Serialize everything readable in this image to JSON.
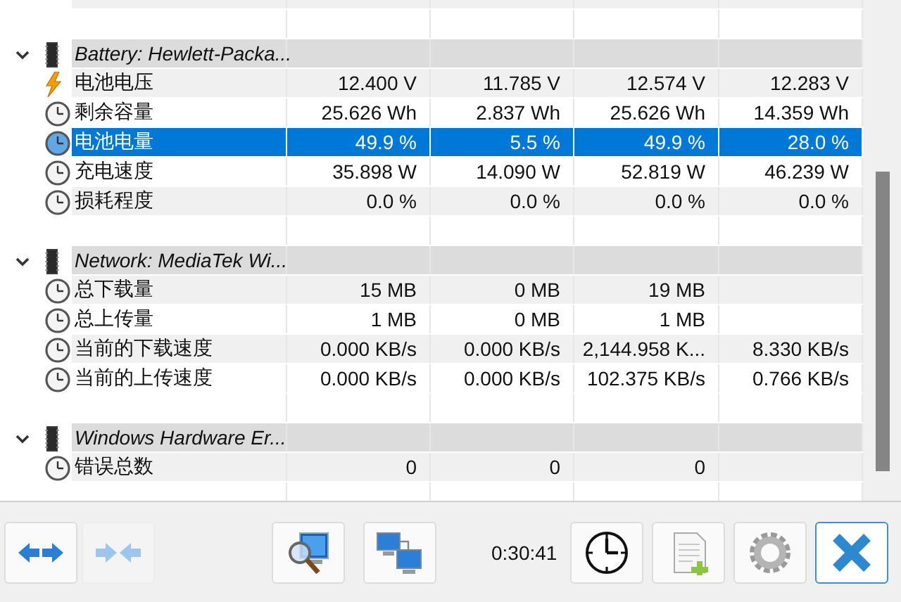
{
  "groups": [
    {
      "title": "Battery: Hewlett-Packa...",
      "expanded": true,
      "rows": [
        {
          "kind": "voltage",
          "label": "电池电压",
          "values": [
            "12.400 V",
            "11.785 V",
            "12.574 V",
            "12.283 V"
          ],
          "selected": false
        },
        {
          "kind": "gauge",
          "label": "剩余容量",
          "values": [
            "25.626 Wh",
            "2.837 Wh",
            "25.626 Wh",
            "14.359 Wh"
          ],
          "selected": false
        },
        {
          "kind": "gauge",
          "label": "电池电量",
          "values": [
            "49.9 %",
            "5.5 %",
            "49.9 %",
            "28.0 %"
          ],
          "selected": true
        },
        {
          "kind": "gauge",
          "label": "充电速度",
          "values": [
            "35.898 W",
            "14.090 W",
            "52.819 W",
            "46.239 W"
          ],
          "selected": false
        },
        {
          "kind": "gauge",
          "label": "损耗程度",
          "values": [
            "0.0 %",
            "0.0 %",
            "0.0 %",
            "0.0 %"
          ],
          "selected": false
        }
      ]
    },
    {
      "title": "Network: MediaTek Wi...",
      "expanded": true,
      "rows": [
        {
          "kind": "gauge",
          "label": "总下载量",
          "values": [
            "15 MB",
            "0 MB",
            "19 MB"
          ],
          "selected": false
        },
        {
          "kind": "gauge",
          "label": "总上传量",
          "values": [
            "1 MB",
            "0 MB",
            "1 MB"
          ],
          "selected": false
        },
        {
          "kind": "gauge",
          "label": "当前的下载速度",
          "values": [
            "0.000 KB/s",
            "0.000 KB/s",
            "2,144.958 K...",
            "8.330 KB/s"
          ],
          "selected": false
        },
        {
          "kind": "gauge",
          "label": "当前的上传速度",
          "values": [
            "0.000 KB/s",
            "0.000 KB/s",
            "102.375 KB/s",
            "0.766 KB/s"
          ],
          "selected": false
        }
      ]
    },
    {
      "title": "Windows Hardware Er...",
      "expanded": true,
      "rows": [
        {
          "kind": "gauge",
          "label": "错误总数",
          "values": [
            "0",
            "0",
            "0"
          ],
          "selected": false
        }
      ]
    }
  ],
  "toolbar": [
    {
      "kind": "expand",
      "disabled": false,
      "focused": false
    },
    {
      "kind": "collapse",
      "disabled": true,
      "focused": false
    },
    {
      "kind": "report",
      "disabled": false,
      "focused": false
    },
    {
      "kind": "network",
      "disabled": false,
      "focused": false
    },
    {
      "kind": "timer",
      "text": "0:30:41"
    },
    {
      "kind": "clock",
      "disabled": false,
      "focused": false
    },
    {
      "kind": "log",
      "disabled": false,
      "focused": false
    },
    {
      "kind": "settings",
      "disabled": false,
      "focused": false
    },
    {
      "kind": "close",
      "disabled": false,
      "focused": true
    }
  ]
}
